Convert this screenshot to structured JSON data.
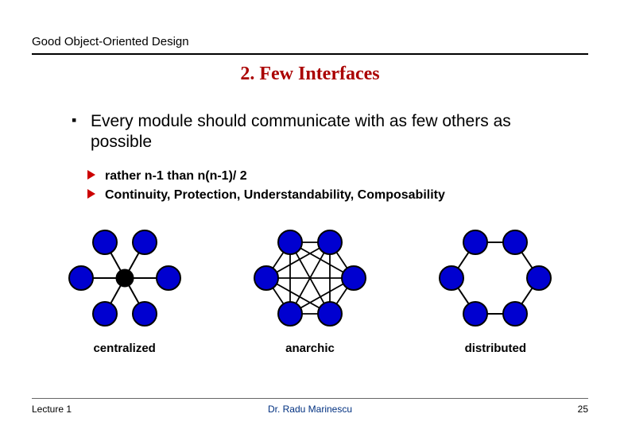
{
  "header": "Good Object-Oriented Design",
  "title": "2. Few Interfaces",
  "bullets": {
    "main": "Every module should communicate with as few others as possible",
    "sub1": "rather n-1 than n(n-1)/ 2",
    "sub2": "Continuity, Protection, Understandability, Composability"
  },
  "diagrams": {
    "label1": "centralized",
    "label2": "anarchic",
    "label3": "distributed"
  },
  "footer": {
    "left": "Lecture 1",
    "center": "Dr. Radu Marinescu",
    "right": "25"
  }
}
